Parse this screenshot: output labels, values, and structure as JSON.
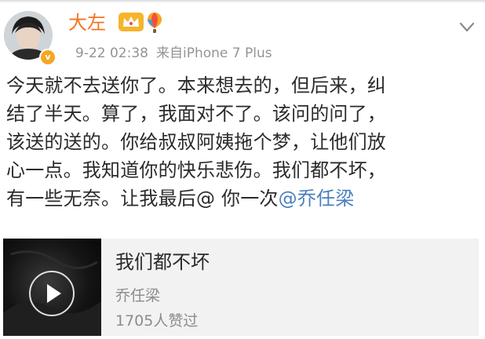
{
  "user": {
    "name": "大左",
    "verified_mark": "v",
    "icons": [
      "crown-icon",
      "balloon-icon"
    ]
  },
  "post": {
    "time": "9-22 02:38",
    "source": "来自iPhone 7 Plus",
    "lines": [
      "今天就不去送你了。本来想去的，但后来，纠",
      "结了半天。算了，我面对不了。该问的问了，",
      "该送的送的。你给叔叔阿姨拖个梦，让他们放",
      "心一点。我知道你的快乐悲伤。我们都不坏，"
    ],
    "last_line_text": "有一些无奈。让我最后@ 你一次",
    "mention": "@乔任梁"
  },
  "music_card": {
    "title": "我们都不坏",
    "artist": "乔任梁",
    "likes": "1705人赞过"
  },
  "colors": {
    "username": "#f5731f",
    "mention": "#4a7fbd",
    "meta": "#949494",
    "card_bg": "#f2f2f2",
    "verified_badge": "#f5a623"
  }
}
